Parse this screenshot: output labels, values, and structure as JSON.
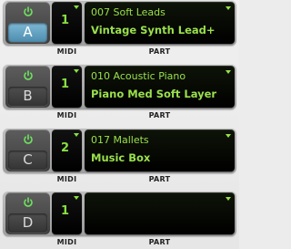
{
  "colors": {
    "accent_green": "#9ae04c",
    "power_green": "#6fe25f",
    "active_letter_blue": "#5f9fc2"
  },
  "labels": {
    "midi": "MIDI",
    "part": "PART"
  },
  "banks": [
    {
      "letter": "A",
      "active": true,
      "power_on": true,
      "midi_channel": "1",
      "part_category": "007 Soft Leads",
      "part_name": "Vintage Synth Lead+"
    },
    {
      "letter": "B",
      "active": false,
      "power_on": true,
      "midi_channel": "1",
      "part_category": "010 Acoustic Piano",
      "part_name": "Piano Med Soft Layer"
    },
    {
      "letter": "C",
      "active": false,
      "power_on": true,
      "midi_channel": "2",
      "part_category": "017 Mallets",
      "part_name": "Music Box"
    },
    {
      "letter": "D",
      "active": false,
      "power_on": true,
      "midi_channel": "1",
      "part_category": "",
      "part_name": ""
    }
  ]
}
